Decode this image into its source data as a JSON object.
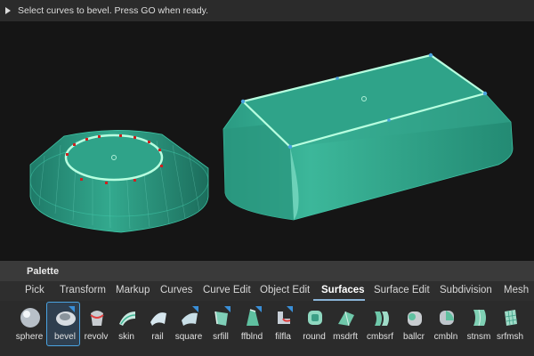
{
  "prompt": {
    "text": "Select curves to bevel. Press GO when ready."
  },
  "palette": {
    "title": "Palette",
    "tabs": [
      "Pick",
      "Transform",
      "Markup",
      "Curves",
      "Curve Edit",
      "Object Edit",
      "Surfaces",
      "Surface Edit",
      "Subdivision",
      "Mesh"
    ],
    "active_tab": "Surfaces",
    "tools": [
      {
        "label": "sphere",
        "icon": "sphere-icon"
      },
      {
        "label": "bevel",
        "icon": "bevel-icon",
        "selected": true
      },
      {
        "label": "revolv",
        "icon": "revolve-icon"
      },
      {
        "label": "skin",
        "icon": "skin-icon"
      },
      {
        "label": "rail",
        "icon": "rail-icon"
      },
      {
        "label": "square",
        "icon": "square-icon"
      },
      {
        "label": "srfill",
        "icon": "surface-fill-icon"
      },
      {
        "label": "ffblnd",
        "icon": "freeform-blend-icon"
      },
      {
        "label": "filfla",
        "icon": "fillet-flange-icon"
      },
      {
        "label": "round",
        "icon": "round-icon"
      },
      {
        "label": "msdrft",
        "icon": "multi-surface-draft-icon"
      },
      {
        "label": "cmbsrf",
        "icon": "combine-surface-icon"
      },
      {
        "label": "ballcr",
        "icon": "ball-corner-icon"
      },
      {
        "label": "cmbln",
        "icon": "combine-blend-icon"
      },
      {
        "label": "stnsm",
        "icon": "stitch-smooth-icon"
      },
      {
        "label": "srfmsh",
        "icon": "surface-mesh-icon"
      }
    ]
  },
  "colors": {
    "surface": "#2f9f86",
    "surface_light": "#5fd0b5",
    "curve_highlight": "#b8ffe0",
    "cv_marker": "#d02020",
    "accent": "#4aa3e0"
  }
}
